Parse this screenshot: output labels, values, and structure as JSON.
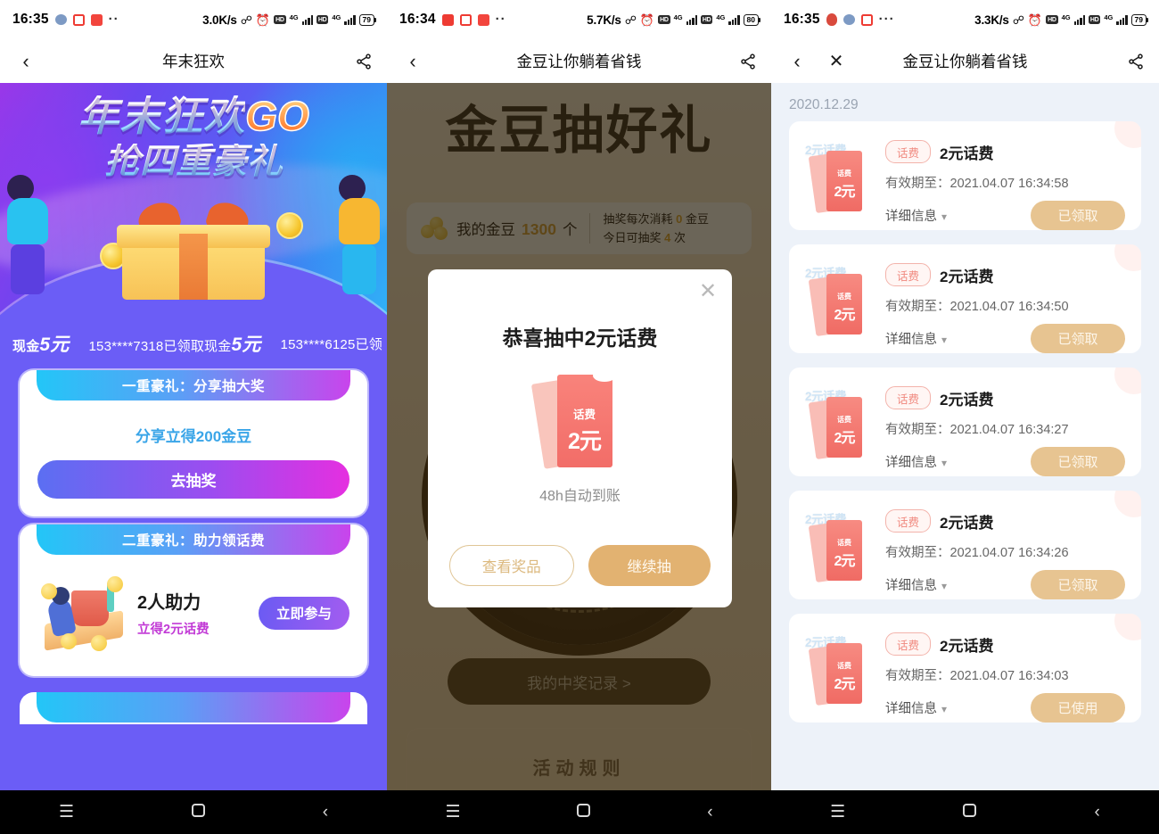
{
  "panels": [
    {
      "status": {
        "time": "16:35",
        "speed": "3.0K/s",
        "battery": "79",
        "net": "4G",
        "hd": "HD",
        "dots": "··"
      },
      "nav": {
        "back": "back-arrow",
        "title": "年末狂欢",
        "share": "share-icon"
      },
      "banner": {
        "line1": "年末狂欢",
        "go": "GO",
        "line2": "抢四重豪礼"
      },
      "ticker": [
        {
          "prefix": "现金",
          "amount": "5元"
        },
        {
          "prefix": "153****7318已领取现金",
          "amount": "5元"
        },
        {
          "prefix": "153****6125已领",
          "amount": ""
        }
      ],
      "cards": [
        {
          "ribbon": "一重豪礼：分享抽大奖",
          "subtitle": "分享立得200金豆",
          "button": "去抽奖"
        },
        {
          "ribbon": "二重豪礼：助力领话费",
          "title": "2人助力",
          "subtitle": "立得2元话费",
          "button": "立即参与"
        },
        {
          "ribbon": ""
        }
      ]
    },
    {
      "status": {
        "time": "16:34",
        "speed": "5.7K/s",
        "battery": "80",
        "net": "4G",
        "hd": "HD",
        "dots": "··"
      },
      "nav": {
        "back": "back-arrow",
        "title": "金豆让你躺着省钱",
        "share": "share-icon"
      },
      "hero": "金豆抽好礼",
      "beans": {
        "label": "我的金豆",
        "count": "1300",
        "unit": "个",
        "cost_prefix": "抽奖每次消耗",
        "cost_value": "0",
        "cost_suffix": "金豆",
        "today_prefix": "今日可抽奖",
        "today_value": "4",
        "today_suffix": "次"
      },
      "record_button": "我的中奖记录 >",
      "rules_title": "活动规则",
      "modal": {
        "close": "close-icon",
        "title": "恭喜抽中2元话费",
        "prize_label": "话费",
        "prize_amount": "2元",
        "note": "48h自动到账",
        "btn_secondary": "查看奖品",
        "btn_primary": "继续抽"
      }
    },
    {
      "status": {
        "time": "16:35",
        "speed": "3.3K/s",
        "battery": "79",
        "net": "4G",
        "hd": "HD",
        "dots": "···"
      },
      "nav": {
        "back": "back-arrow",
        "close": "close-icon",
        "title": "金豆让你躺着省钱",
        "share": "share-icon"
      },
      "date": "2020.12.29",
      "records": [
        {
          "thumb_label": "2元话费",
          "thumb_l1": "话费",
          "thumb_l2": "2元",
          "tag": "话费",
          "title": "2元话费",
          "expiry": "有效期至：2021.04.07 16:34:58",
          "detail": "详细信息",
          "status": "已领取"
        },
        {
          "thumb_label": "2元话费",
          "thumb_l1": "话费",
          "thumb_l2": "2元",
          "tag": "话费",
          "title": "2元话费",
          "expiry": "有效期至：2021.04.07 16:34:50",
          "detail": "详细信息",
          "status": "已领取"
        },
        {
          "thumb_label": "2元话费",
          "thumb_l1": "话费",
          "thumb_l2": "2元",
          "tag": "话费",
          "title": "2元话费",
          "expiry": "有效期至：2021.04.07 16:34:27",
          "detail": "详细信息",
          "status": "已领取"
        },
        {
          "thumb_label": "2元话费",
          "thumb_l1": "话费",
          "thumb_l2": "2元",
          "tag": "话费",
          "title": "2元话费",
          "expiry": "有效期至：2021.04.07 16:34:26",
          "detail": "详细信息",
          "status": "已领取"
        },
        {
          "thumb_label": "2元话费",
          "thumb_l1": "话费",
          "thumb_l2": "2元",
          "tag": "话费",
          "title": "2元话费",
          "expiry": "有效期至：2021.04.07 16:34:03",
          "detail": "详细信息",
          "status": "已使用"
        }
      ]
    }
  ],
  "android_nav": {
    "menu": "menu-icon",
    "home": "home-icon",
    "back": "back-icon"
  },
  "colors": {
    "purple_bg": "#6b5df6",
    "accent_gold": "#e2b271",
    "coupon_red": "#f26d68",
    "list_bg": "#edf2f9"
  }
}
